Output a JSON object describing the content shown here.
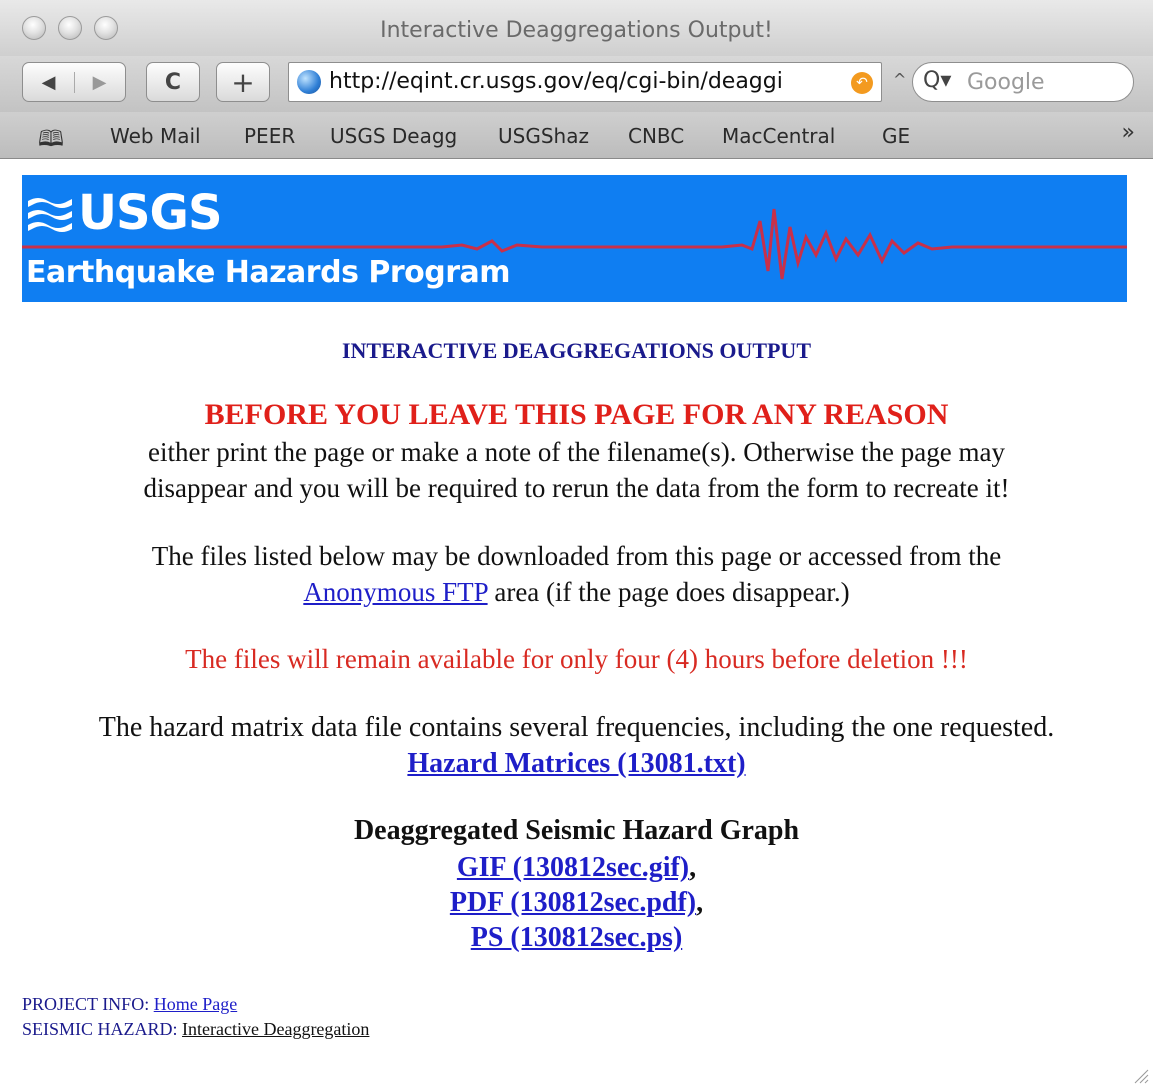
{
  "window": {
    "title": "Interactive Deaggregations Output!"
  },
  "toolbar": {
    "back_label": "◀",
    "forward_label": "▶",
    "reload_label": "C",
    "add_label": "+",
    "url": "http://eqint.cr.usgs.gov/eq/cgi-bin/deaggi",
    "search_placeholder": "Google",
    "search_glyph": "Q▾"
  },
  "bookmarks": {
    "items": [
      "Web Mail",
      "PEER",
      "USGS Deagg",
      "USGShaz",
      "CNBC",
      "MacCentral",
      "GE"
    ],
    "more": "»"
  },
  "banner": {
    "logo_text": "USGS",
    "program": "Earthquake Hazards Program",
    "background": "#0f7ef2",
    "trace_color": "#c8304a"
  },
  "content": {
    "heading": "INTERACTIVE DEAGGREGATIONS OUTPUT",
    "warning_title": "BEFORE YOU LEAVE THIS PAGE FOR ANY REASON",
    "warning_line1": "either print the page or make a note of the filename(s). Otherwise the page may",
    "warning_line2": "disappear and you will be required to rerun the data from the form to recreate it!",
    "files_line1": "The files listed below may be downloaded from this page or accessed from the",
    "ftp_link": "Anonymous FTP",
    "files_line2_rest": " area (if the page does disappear.)",
    "deletion_note": "The files will remain available for only four (4) hours before deletion !!!",
    "matrix_text": "The hazard matrix data file contains several frequencies, including the one requested.",
    "matrix_link": "Hazard Matrices (13081.txt)",
    "graph_title": "Deaggregated Seismic Hazard Graph",
    "gif_link": "GIF (130812sec.gif)",
    "pdf_link": "PDF (130812sec.pdf)",
    "ps_link": "PS (130812sec.ps)",
    "comma": ","
  },
  "footer": {
    "project_label": "PROJECT INFO: ",
    "project_link": "Home Page",
    "seismic_label": "SEISMIC HAZARD: ",
    "seismic_link": "Interactive Deaggregation"
  }
}
